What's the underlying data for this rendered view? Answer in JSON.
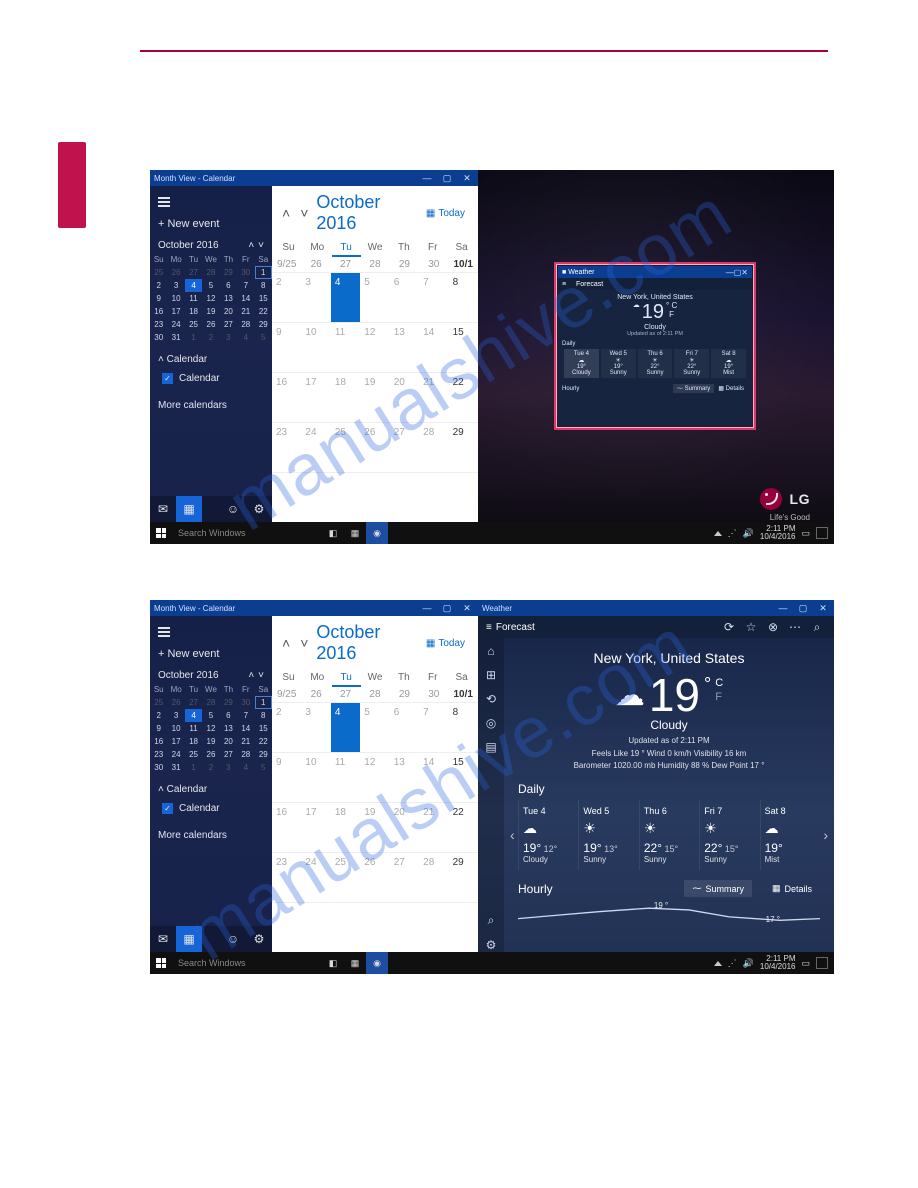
{
  "watermark": "manualshive.com",
  "branding": {
    "logo_text": "LG",
    "logo_sub": "Life's Good"
  },
  "taskbar": {
    "search_placeholder": "Search Windows",
    "time": "2:11 PM",
    "date": "10/4/2016"
  },
  "calendar": {
    "window_title": "Month View - Calendar",
    "new_event": "+  New event",
    "mini_title": "October 2016",
    "today_label": "Today",
    "dow": [
      "Su",
      "Mo",
      "Tu",
      "We",
      "Th",
      "Fr",
      "Sa"
    ],
    "title": "October 2016",
    "date_row": [
      "9/25",
      "26",
      "27",
      "28",
      "29",
      "30",
      "10/1"
    ],
    "mini_rows": [
      [
        "25",
        "26",
        "27",
        "28",
        "29",
        "30",
        "1"
      ],
      [
        "2",
        "3",
        "4",
        "5",
        "6",
        "7",
        "8"
      ],
      [
        "9",
        "10",
        "11",
        "12",
        "13",
        "14",
        "15"
      ],
      [
        "16",
        "17",
        "18",
        "19",
        "20",
        "21",
        "22"
      ],
      [
        "23",
        "24",
        "25",
        "26",
        "27",
        "28",
        "29"
      ],
      [
        "30",
        "31",
        "1",
        "2",
        "3",
        "4",
        "5"
      ]
    ],
    "section_calendar": "Calendar",
    "checkbox_calendar": "Calendar",
    "more_calendars": "More calendars",
    "grid": [
      [
        "2",
        "3",
        "4",
        "5",
        "6",
        "7",
        "8"
      ],
      [
        "9",
        "10",
        "11",
        "12",
        "13",
        "14",
        "15"
      ],
      [
        "16",
        "17",
        "18",
        "19",
        "20",
        "21",
        "22"
      ],
      [
        "23",
        "24",
        "25",
        "26",
        "27",
        "28",
        "29"
      ],
      [
        "",
        "",
        "",
        "",
        "",
        "",
        ""
      ]
    ]
  },
  "weather_small": {
    "title": "Weather",
    "forecast": "Forecast",
    "location": "New York, United States",
    "temp": "19",
    "condition": "Cloudy",
    "updated": "Updated as of 2:11 PM",
    "daily": [
      {
        "d": "Tue 4",
        "hi": "19°",
        "c": "Cloudy"
      },
      {
        "d": "Wed 5",
        "hi": "19°",
        "c": "Sunny"
      },
      {
        "d": "Thu 6",
        "hi": "22°",
        "c": "Sunny"
      },
      {
        "d": "Fri 7",
        "hi": "22°",
        "c": "Sunny"
      },
      {
        "d": "Sat 8",
        "hi": "19°",
        "c": "Mist"
      }
    ],
    "hourly": "Hourly",
    "summary": "Summary",
    "details": "Details"
  },
  "weather": {
    "title": "Weather",
    "forecast": "Forecast",
    "location": "New York, United States",
    "temp": "19",
    "unit_c": "C",
    "unit_f": "F",
    "condition": "Cloudy",
    "updated": "Updated as of 2:11 PM",
    "meta_line1": "Feels Like  19 °     Wind   0 km/h     Visibility  16 km",
    "meta_line2": "Barometer  1020.00 mb     Humidity  88 %     Dew Point  17 °",
    "daily_label": "Daily",
    "hourly_label": "Hourly",
    "summary": "Summary",
    "details": "Details",
    "spark_hi": "19 °",
    "spark_lo": "17 °",
    "daily": [
      {
        "d": "Tue 4",
        "ico": "☁",
        "hi": "19°",
        "lo": "12°",
        "c": "Cloudy"
      },
      {
        "d": "Wed 5",
        "ico": "☀",
        "hi": "19°",
        "lo": "13°",
        "c": "Sunny"
      },
      {
        "d": "Thu 6",
        "ico": "☀",
        "hi": "22°",
        "lo": "15°",
        "c": "Sunny"
      },
      {
        "d": "Fri 7",
        "ico": "☀",
        "hi": "22°",
        "lo": "15°",
        "c": "Sunny"
      },
      {
        "d": "Sat 8",
        "ico": "☁",
        "hi": "19°",
        "lo": "",
        "c": "Mist"
      }
    ]
  }
}
